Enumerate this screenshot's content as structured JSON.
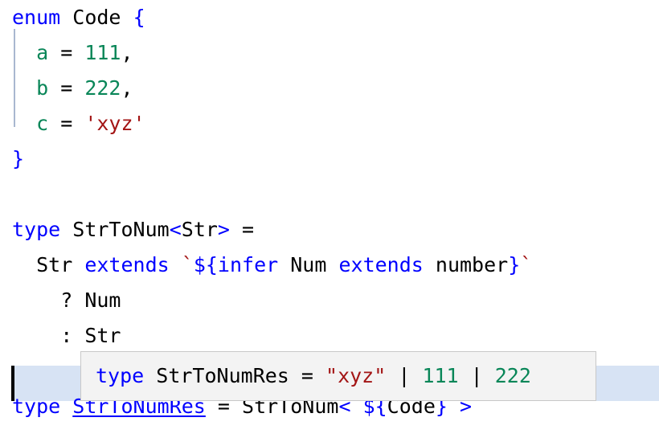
{
  "editor": {
    "language": "typescript",
    "background": "#ffffff",
    "colors": {
      "keyword": "#0000ff",
      "identifier": "#000000",
      "number": "#098658",
      "string": "#a31515",
      "enum_member": "#098658",
      "backtick": "#a31515",
      "line_highlight": "#d7e3f4",
      "indent_guide": "#a9b7d0",
      "tooltip_background": "#f3f3f3",
      "tooltip_border": "#c8c8c8",
      "cursor": "#000000",
      "link": "#0000ff"
    }
  },
  "code_lines": [
    {
      "n": 1,
      "indent": "",
      "tokens": [
        {
          "t": "enum",
          "c": "kw"
        },
        {
          "t": " ",
          "c": "punc"
        },
        {
          "t": "Code",
          "c": "id"
        },
        {
          "t": " ",
          "c": "punc"
        },
        {
          "t": "{",
          "c": "kw"
        }
      ]
    },
    {
      "n": 2,
      "indent": "  ",
      "tokens": [
        {
          "t": "a",
          "c": "enumem"
        },
        {
          "t": " = ",
          "c": "punc"
        },
        {
          "t": "111",
          "c": "num"
        },
        {
          "t": ",",
          "c": "punc"
        }
      ]
    },
    {
      "n": 3,
      "indent": "  ",
      "tokens": [
        {
          "t": "b",
          "c": "enumem"
        },
        {
          "t": " = ",
          "c": "punc"
        },
        {
          "t": "222",
          "c": "num"
        },
        {
          "t": ",",
          "c": "punc"
        }
      ]
    },
    {
      "n": 4,
      "indent": "  ",
      "tokens": [
        {
          "t": "c",
          "c": "enumem"
        },
        {
          "t": " = ",
          "c": "punc"
        },
        {
          "t": "'xyz'",
          "c": "str"
        }
      ]
    },
    {
      "n": 5,
      "indent": "",
      "tokens": [
        {
          "t": "}",
          "c": "kw"
        }
      ]
    },
    {
      "n": 6,
      "indent": "",
      "tokens": []
    },
    {
      "n": 7,
      "indent": "",
      "tokens": [
        {
          "t": "type",
          "c": "kw"
        },
        {
          "t": " ",
          "c": "punc"
        },
        {
          "t": "StrToNum",
          "c": "id"
        },
        {
          "t": "<",
          "c": "ang"
        },
        {
          "t": "Str",
          "c": "id"
        },
        {
          "t": ">",
          "c": "ang"
        },
        {
          "t": " = ",
          "c": "punc"
        }
      ]
    },
    {
      "n": 8,
      "indent": "  ",
      "tokens": [
        {
          "t": "Str",
          "c": "id"
        },
        {
          "t": " ",
          "c": "punc"
        },
        {
          "t": "extends",
          "c": "kw"
        },
        {
          "t": " ",
          "c": "punc"
        },
        {
          "t": "`",
          "c": "tick"
        },
        {
          "t": "${",
          "c": "kw"
        },
        {
          "t": "infer",
          "c": "kw"
        },
        {
          "t": " ",
          "c": "punc"
        },
        {
          "t": "Num",
          "c": "id"
        },
        {
          "t": " ",
          "c": "punc"
        },
        {
          "t": "extends",
          "c": "kw"
        },
        {
          "t": " ",
          "c": "punc"
        },
        {
          "t": "number",
          "c": "id"
        },
        {
          "t": "}",
          "c": "kw"
        },
        {
          "t": "`",
          "c": "tick"
        }
      ]
    },
    {
      "n": 9,
      "indent": "    ",
      "tokens": [
        {
          "t": "? ",
          "c": "punc"
        },
        {
          "t": "Num",
          "c": "id"
        }
      ]
    },
    {
      "n": 10,
      "indent": "    ",
      "tokens": [
        {
          "t": ": ",
          "c": "punc"
        },
        {
          "t": "Str",
          "c": "id"
        }
      ]
    },
    {
      "n": 11,
      "indent": "",
      "tokens": []
    },
    {
      "n": 12,
      "indent": "",
      "tokens": [
        {
          "t": "type",
          "c": "kw"
        },
        {
          "t": " ",
          "c": "punc"
        },
        {
          "t": "StrToNumRes",
          "c": "link"
        },
        {
          "t": " = ",
          "c": "punc"
        },
        {
          "t": "StrToNum",
          "c": "id"
        },
        {
          "t": "<",
          "c": "ang"
        },
        {
          "t": "`",
          "c": "tick"
        },
        {
          "t": "${",
          "c": "kw"
        },
        {
          "t": "Code",
          "c": "id"
        },
        {
          "t": "}",
          "c": "kw"
        },
        {
          "t": "`",
          "c": "tick"
        },
        {
          "t": ">",
          "c": "ang"
        }
      ]
    }
  ],
  "hover_tooltip": {
    "visible": true,
    "tokens": [
      {
        "t": "type",
        "c": "kw"
      },
      {
        "t": " ",
        "c": "punc"
      },
      {
        "t": "StrToNumRes",
        "c": "id"
      },
      {
        "t": " = ",
        "c": "punc"
      },
      {
        "t": "\"xyz\"",
        "c": "str"
      },
      {
        "t": " | ",
        "c": "punc"
      },
      {
        "t": "111",
        "c": "num"
      },
      {
        "t": " | ",
        "c": "punc"
      },
      {
        "t": "222",
        "c": "num"
      }
    ],
    "plain_text": "type StrToNumRes = \"xyz\" | 111 | 222"
  },
  "cursor": {
    "line": 11,
    "column": 1
  }
}
